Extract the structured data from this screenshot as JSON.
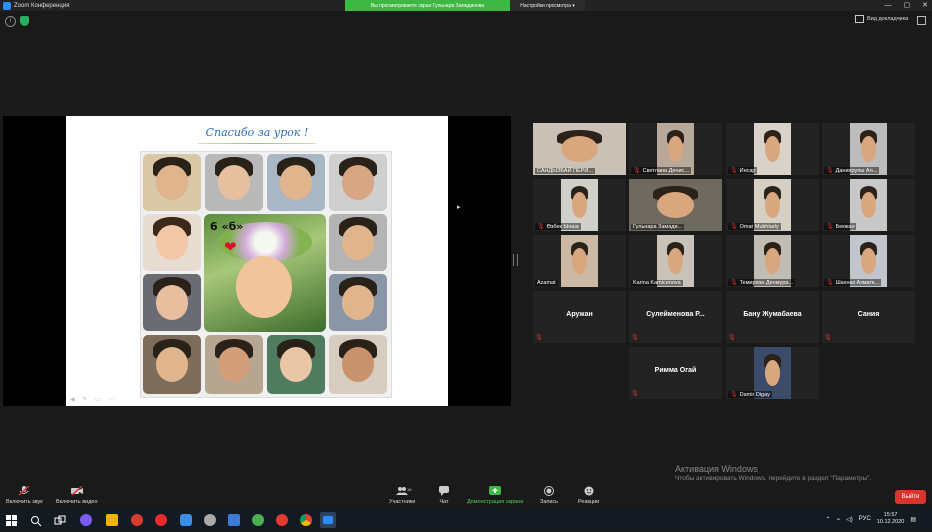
{
  "window": {
    "title": "Zoom Конференция",
    "share_banner": "Вы просматриваете экран Гульнара Замадинова",
    "view_options": "Настройки просмотра",
    "view_mode": "Вид докладчика",
    "controls": [
      "—",
      "▢",
      "✕"
    ]
  },
  "slide": {
    "title": "Спасибо за урок !",
    "center_text": "6 «б»",
    "heart": "❤",
    "footer": "◀ ✎ ▭ ⋯"
  },
  "gallery": {
    "tiles": [
      {
        "name": "САНДЫЗБАЙ ПЕРИ...",
        "type": "video",
        "muted": false
      },
      {
        "name": "Светлана Денис...",
        "type": "video",
        "muted": true
      },
      {
        "name": "Инсар",
        "type": "video",
        "muted": true
      },
      {
        "name": "Даниярулы Ал...",
        "type": "video",
        "muted": true
      },
      {
        "name": "Өзбек Ынша",
        "type": "video",
        "muted": true
      },
      {
        "name": "Гульнара Замади...",
        "type": "video",
        "muted": false,
        "active": true
      },
      {
        "name": "Omar Mukhtarly",
        "type": "video",
        "muted": true
      },
      {
        "name": "Бекжан",
        "type": "video",
        "muted": true
      },
      {
        "name": "Azamat",
        "type": "video",
        "muted": false
      },
      {
        "name": "Karina Kamicenova",
        "type": "video",
        "muted": false
      },
      {
        "name": "Темирхан Денмура...",
        "type": "video",
        "muted": true
      },
      {
        "name": "Шахназ Азматк...",
        "type": "video",
        "muted": true
      },
      {
        "name": "Аружан",
        "type": "name",
        "muted": true
      },
      {
        "name": "Сулейменова Р...",
        "type": "name",
        "muted": true
      },
      {
        "name": "Бану Жумабаева",
        "type": "name",
        "muted": true
      },
      {
        "name": "Сания",
        "type": "name",
        "muted": true
      },
      {
        "name": "Римма Огай",
        "type": "name",
        "muted": true
      },
      {
        "name": "Damir Digay",
        "type": "video",
        "muted": true
      }
    ]
  },
  "toolbar": {
    "unmute": "Включить звук",
    "start_video": "Включить видео",
    "participants": "Участники",
    "participants_count": "18",
    "chat": "Чат",
    "share_screen": "Демонстрация экрана",
    "record": "Запись",
    "reactions": "Реакции",
    "leave": "Выйти"
  },
  "activation": {
    "title": "Активация Windows",
    "subtitle": "Чтобы активировать Windows, перейдите в раздел \"Параметры\"."
  },
  "taskbar": {
    "lang": "РУС",
    "time": "15:57",
    "date": "10.12.2020"
  },
  "colors": {
    "zoom_blue": "#2d8cff",
    "share_green": "#3db843",
    "leave_red": "#d9352c",
    "active_speaker": "#c6d93a"
  }
}
